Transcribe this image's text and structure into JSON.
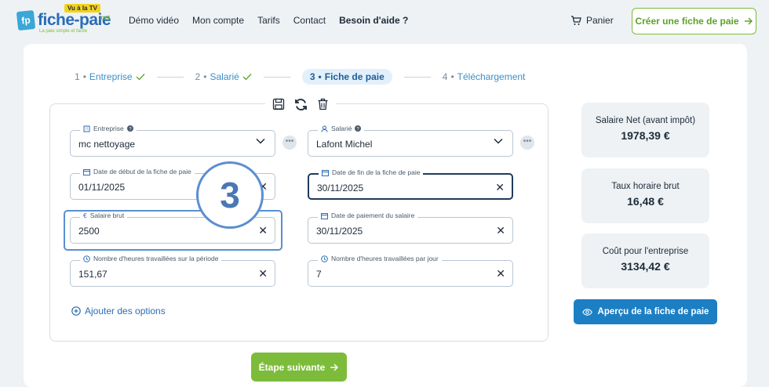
{
  "header": {
    "logo": {
      "brand": "fiche-paie",
      "tv_badge": "Vu à la TV",
      "tld": ".net",
      "tagline": "La paie simple et facile"
    },
    "nav": [
      {
        "label": "Démo vidéo",
        "bold": false
      },
      {
        "label": "Mon compte",
        "bold": false
      },
      {
        "label": "Tarifs",
        "bold": false
      },
      {
        "label": "Contact",
        "bold": false
      },
      {
        "label": "Besoin d'aide ?",
        "bold": true
      }
    ],
    "cart_label": "Panier",
    "create_button": "Créer une fiche de paie"
  },
  "steps": [
    {
      "num": "1",
      "label": "Entreprise",
      "done": true
    },
    {
      "num": "2",
      "label": "Salarié",
      "done": true
    },
    {
      "num": "3",
      "label": "Fiche de paie",
      "active": true
    },
    {
      "num": "4",
      "label": "Téléchargement"
    }
  ],
  "form": {
    "entreprise": {
      "label": "Entreprise",
      "value": "mc nettoyage"
    },
    "salarie": {
      "label": "Salarié",
      "value": "Lafont Michel"
    },
    "date_debut": {
      "label": "Date de début de la fiche de paie",
      "value": "01/11/2025"
    },
    "date_fin": {
      "label": "Date de fin de la fiche de paie",
      "value": "30/11/2025"
    },
    "salaire_brut": {
      "label": "Salaire brut",
      "value": "2500"
    },
    "date_paiement": {
      "label": "Date de paiement du salaire",
      "value": "30/11/2025"
    },
    "heures_periode": {
      "label": "Nombre d'heures travaillées sur la période",
      "value": "151,67"
    },
    "heures_jour": {
      "label": "Nombre d'heures travaillées par jour",
      "value": "7"
    },
    "add_options": "Ajouter des options",
    "callout_number": "3"
  },
  "next_button": "Étape suivante",
  "summary": [
    {
      "label": "Salaire Net (avant impôt)",
      "value": "1978,39 €"
    },
    {
      "label": "Taux horaire brut",
      "value": "16,48 €"
    },
    {
      "label": "Coût pour l'entreprise",
      "value": "3134,42 €"
    }
  ],
  "preview_button": "Aperçu de la fiche de paie"
}
